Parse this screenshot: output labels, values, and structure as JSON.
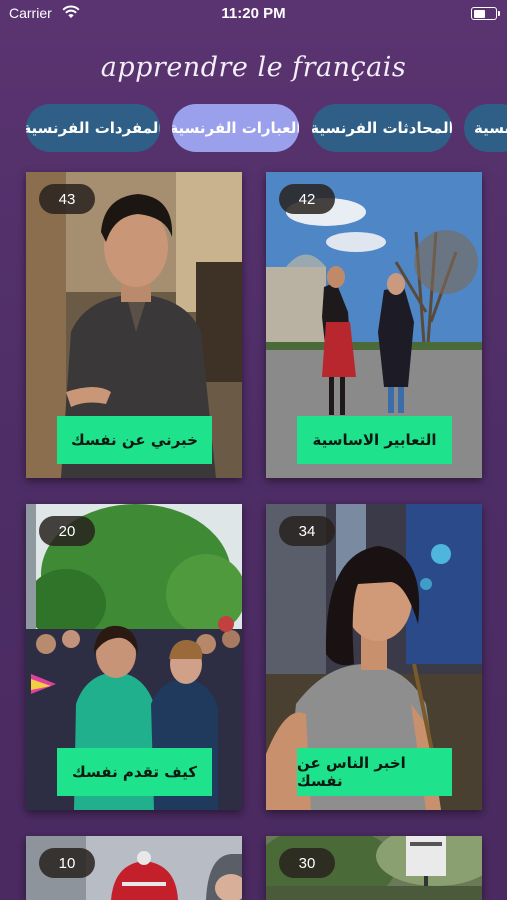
{
  "status": {
    "carrier": "Carrier",
    "time": "11:20 PM"
  },
  "app": {
    "title": "apprendre le français"
  },
  "tabs": [
    {
      "label": "المفردات الفرنسية",
      "active": false
    },
    {
      "label": "العبارات الفرنسية",
      "active": true
    },
    {
      "label": "المحادثات الفرنسية",
      "active": false
    },
    {
      "label": "نسية",
      "active": false
    }
  ],
  "cards": [
    {
      "count": "43",
      "label": "خبرني عن نفسك",
      "icon": "man-portrait-photo"
    },
    {
      "count": "42",
      "label": "التعابير الاساسية",
      "icon": "women-walking-street-photo"
    },
    {
      "count": "20",
      "label": "كيف تقدم نفسك",
      "icon": "crowd-park-photo"
    },
    {
      "count": "34",
      "label": "اخبر الناس عن نفسك",
      "icon": "woman-portrait-photo"
    },
    {
      "count": "10",
      "icon": "crowd-hats-photo"
    },
    {
      "count": "30",
      "icon": "park-sign-photo"
    }
  ],
  "colors": {
    "background": "#4e2d66",
    "tab": "#2f5f87",
    "tab_active": "#9aa0ec",
    "label_bg": "#1ee38c"
  }
}
